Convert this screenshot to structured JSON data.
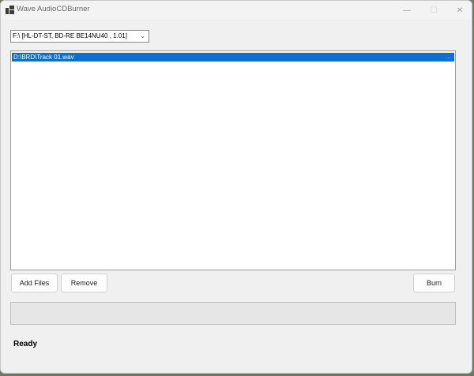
{
  "window": {
    "title": "Wave AudioCDBurner",
    "controls": {
      "minimize_glyph": "—",
      "maximize_glyph": "☐",
      "close_glyph": "✕"
    }
  },
  "drive": {
    "selected": "F:\\ [HL-DT-ST, BD-RE  BE14NU40 , 1.01]",
    "chevron_glyph": "⌄"
  },
  "files": {
    "items": [
      {
        "path": "D:\\BRD\\Track 01.wav",
        "selected": true
      }
    ],
    "row_marker": "..."
  },
  "buttons": {
    "add_files": "Add Files",
    "remove": "Remove",
    "burn": "Burn"
  },
  "progress": {
    "value_percent": 0
  },
  "status": {
    "text": "Ready"
  },
  "colors": {
    "selection": "#0a6fd6",
    "window_bg": "#f0f0f0",
    "progress_fill": "#06b025"
  },
  "icons": {
    "app": "app-window-icon"
  }
}
